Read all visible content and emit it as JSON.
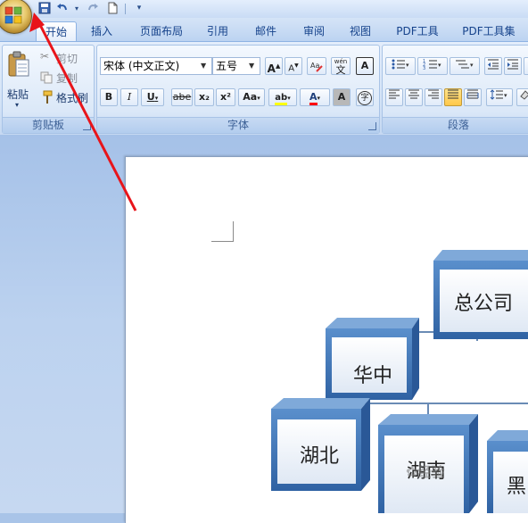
{
  "quick_access": {
    "save_icon": "save-icon",
    "undo_icon": "undo-icon",
    "redo_icon": "redo-icon",
    "new_icon": "new-document-icon"
  },
  "tabs": [
    {
      "label": "开始",
      "active": true
    },
    {
      "label": "插入"
    },
    {
      "label": "页面布局"
    },
    {
      "label": "引用"
    },
    {
      "label": "邮件"
    },
    {
      "label": "审阅"
    },
    {
      "label": "视图"
    },
    {
      "label": "PDF工具"
    },
    {
      "label": "PDF工具集"
    }
  ],
  "clipboard": {
    "group_label": "剪贴板",
    "paste_label": "粘贴",
    "cut_label": "剪切",
    "copy_label": "复制",
    "format_painter_label": "格式刷"
  },
  "font": {
    "group_label": "字体",
    "font_name": "宋体 (中文正文)",
    "font_size": "五号",
    "bold": "B",
    "italic": "I",
    "underline": "U",
    "strike": "abe",
    "subscript": "x₂",
    "superscript": "x²",
    "change_case": "Aa",
    "grow": "A",
    "shrink": "A",
    "font_color_letter": "A",
    "char_shading": "A",
    "phonetic": "wén",
    "phonetic_char": "文",
    "border_char": "A",
    "enclose_char": "字",
    "highlight_letters": "ab",
    "highlight_color": "#ffff00",
    "font_color": "#ff0000"
  },
  "paragraph": {
    "group_label": "段落"
  },
  "org_chart": {
    "nodes": [
      "总公司",
      "华中",
      "湖北",
      "湖南",
      "黑"
    ],
    "box_color": "#3f75b5",
    "box_face": "#e8eef7"
  },
  "watermark": "经验"
}
